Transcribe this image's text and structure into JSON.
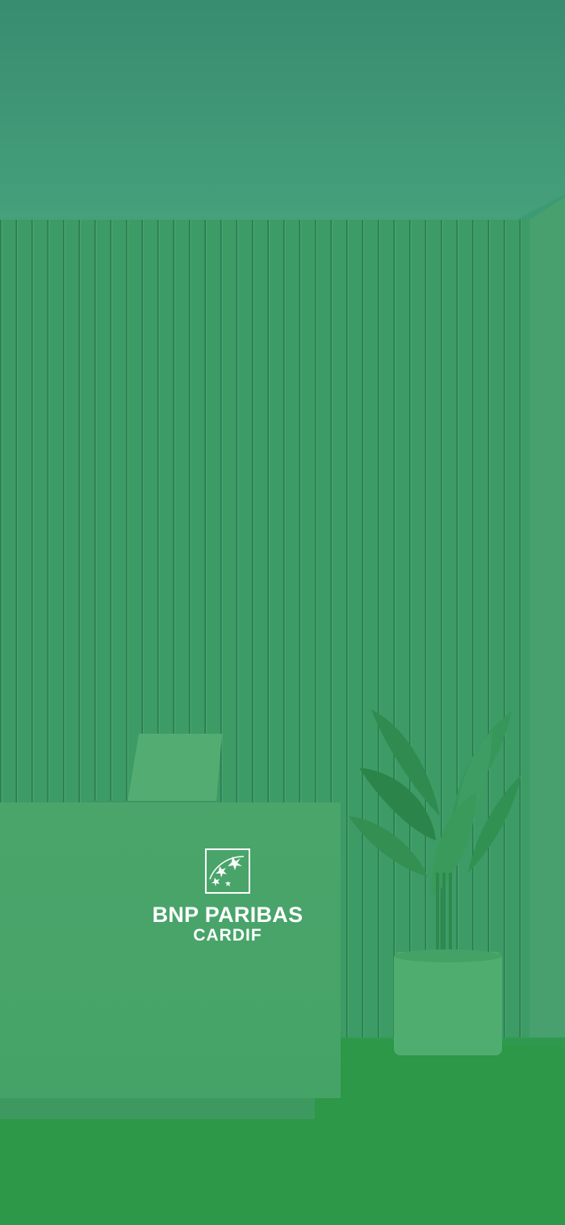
{
  "splash": {
    "brand_name": "BNP PARIBAS",
    "brand_sub": "CARDIF",
    "logo_icon": "bnp-stars-logo-icon",
    "background": "green-tinted office reception photo",
    "colors": {
      "ceiling": "#3f9677",
      "wall": "#3c9a66",
      "floor": "#2f9a4e",
      "desk": "#4aa56a",
      "logo": "#ffffff"
    }
  }
}
